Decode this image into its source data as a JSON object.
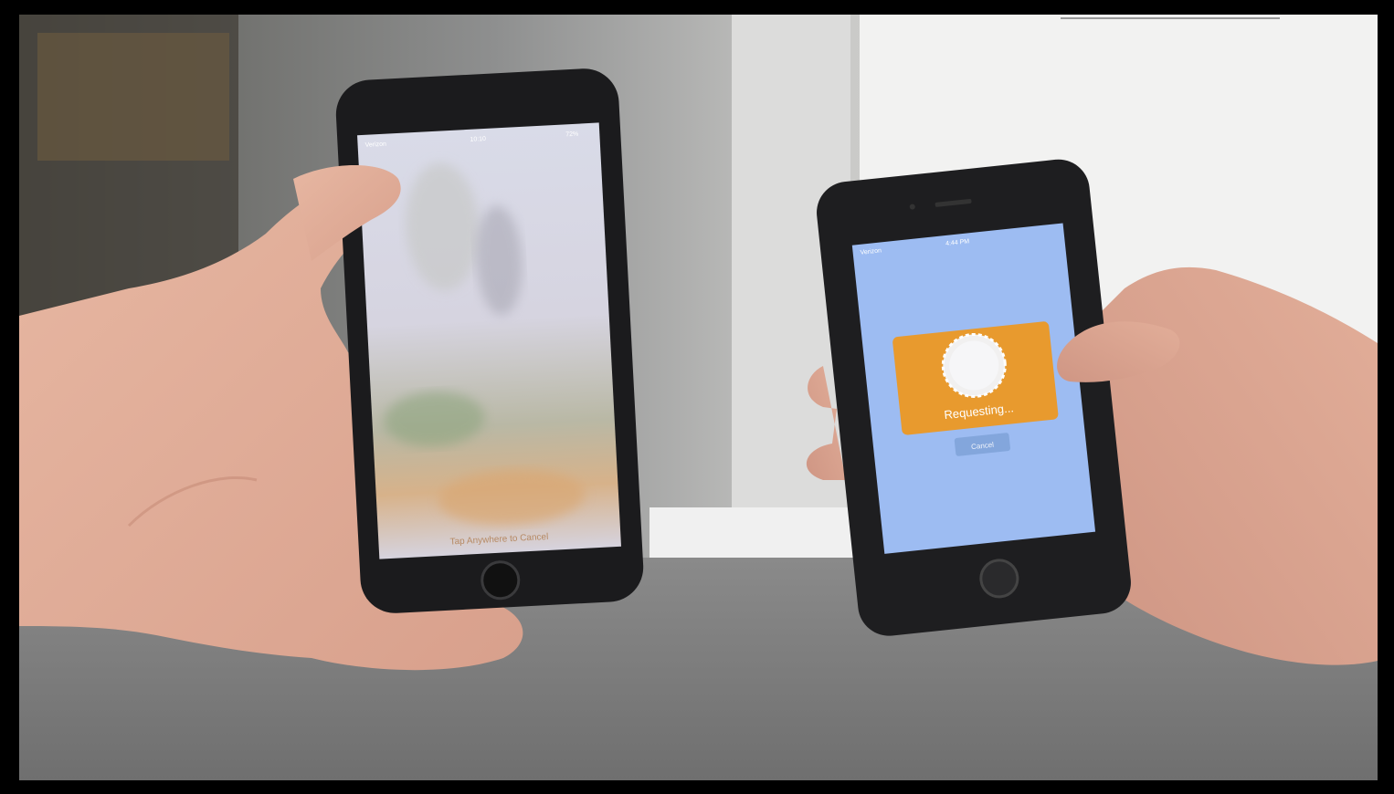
{
  "left_phone": {
    "status_carrier": "Verizon",
    "status_time": "10:10",
    "status_battery": "72%",
    "overlay_text": "Tap Anywhere to Cancel"
  },
  "right_phone": {
    "status_carrier": "Verizon",
    "status_time": "4:44 PM",
    "request_card_label": "Requesting...",
    "cancel_label": "Cancel",
    "card_color": "#e89a2e",
    "screen_color": "#9dbcf2"
  }
}
